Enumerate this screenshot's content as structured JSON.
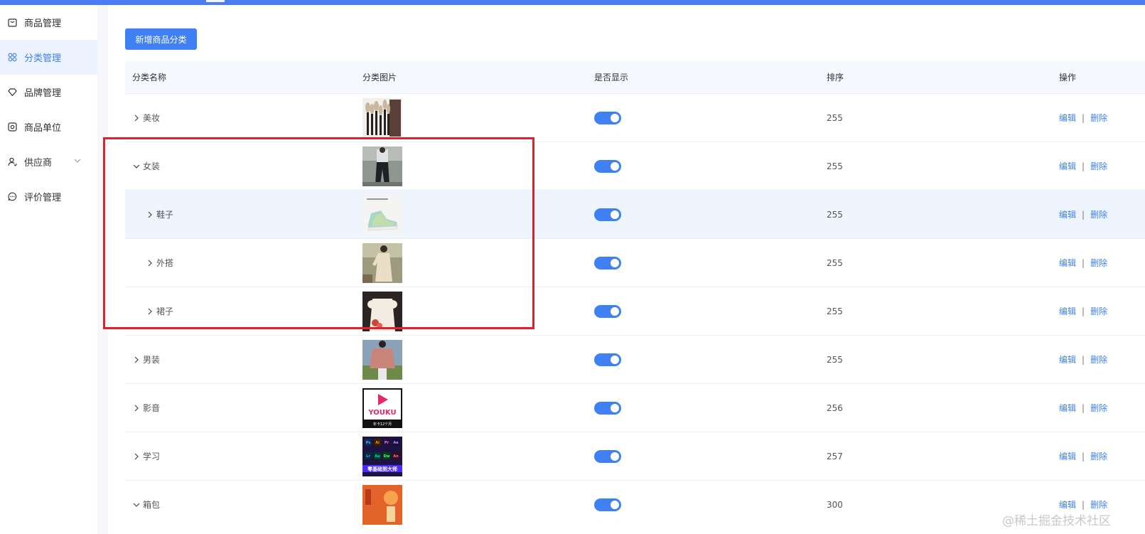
{
  "sidebar": {
    "items": [
      {
        "label": "商品管理",
        "icon": "shopping-bag-icon",
        "active": false
      },
      {
        "label": "分类管理",
        "icon": "category-grid-icon",
        "active": true
      },
      {
        "label": "品牌管理",
        "icon": "diamond-icon",
        "active": false
      },
      {
        "label": "商品单位",
        "icon": "unit-icon",
        "active": false
      },
      {
        "label": "供应商",
        "icon": "supplier-user-icon",
        "active": false,
        "expandable": true
      },
      {
        "label": "评价管理",
        "icon": "comment-icon",
        "active": false
      }
    ]
  },
  "toolbar": {
    "add_label": "新增商品分类"
  },
  "table": {
    "headers": {
      "name": "分类名称",
      "image": "分类图片",
      "show": "是否显示",
      "sort": "排序",
      "ops": "操作"
    },
    "rows": [
      {
        "name": "美妆",
        "level": 0,
        "expanded": false,
        "sort": "255",
        "image": "makeup-brushes",
        "show": true
      },
      {
        "name": "女装",
        "level": 0,
        "expanded": true,
        "sort": "255",
        "image": "womens-outfit",
        "show": true
      },
      {
        "name": "鞋子",
        "level": 1,
        "expanded": false,
        "sort": "255",
        "image": "sneakers",
        "show": true
      },
      {
        "name": "外搭",
        "level": 1,
        "expanded": false,
        "sort": "255",
        "image": "dress-outer",
        "show": true
      },
      {
        "name": "裙子",
        "level": 1,
        "expanded": false,
        "sort": "255",
        "image": "skirt-dress",
        "show": true
      },
      {
        "name": "男装",
        "level": 0,
        "expanded": false,
        "sort": "255",
        "image": "mens-shirt",
        "show": true
      },
      {
        "name": "影音",
        "level": 0,
        "expanded": false,
        "sort": "256",
        "image": "youku-card",
        "show": true
      },
      {
        "name": "学习",
        "level": 0,
        "expanded": false,
        "sort": "257",
        "image": "software-icons",
        "show": true
      },
      {
        "name": "箱包",
        "level": 0,
        "expanded": true,
        "sort": "300",
        "image": "festival-poster",
        "show": true
      }
    ],
    "edit_label": "编辑",
    "delete_label": "删除",
    "separator": "|"
  },
  "thumb_text": {
    "youku": "YOUKU",
    "youku_sub": "年卡12个月",
    "software_banner": "零基础到大师",
    "software_icons": [
      "Ps",
      "Ai",
      "Pr",
      "Ae",
      "Lr",
      "Au",
      "Dw",
      "An"
    ]
  },
  "watermark": "@稀土掘金技术社区",
  "colors": {
    "accent": "#4080f5",
    "highlight_box": "#e0202a",
    "active_bg": "#ecf3ff"
  }
}
